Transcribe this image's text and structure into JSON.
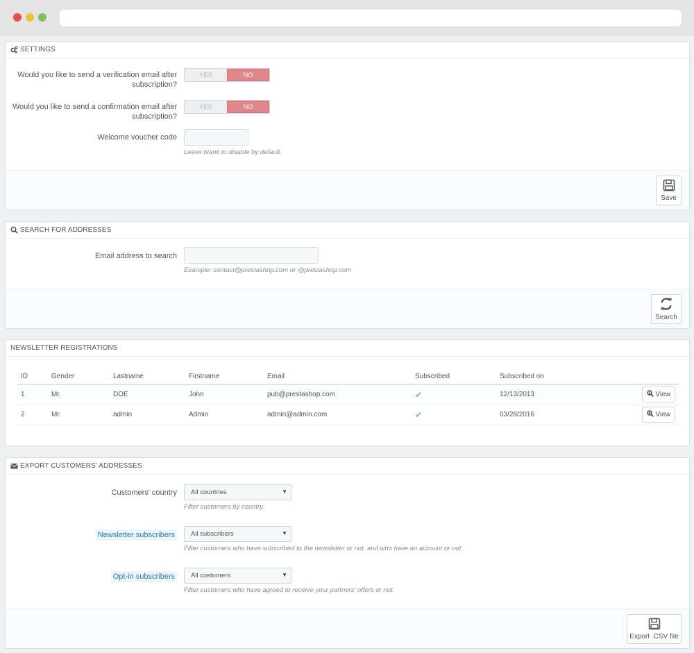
{
  "settings": {
    "title": "Settings",
    "verification_label": "Would you like to send a verification email after subscription?",
    "confirmation_label": "Would you like to send a confirmation email after subscription?",
    "yes": "YES",
    "no": "NO",
    "voucher_label": "Welcome voucher code",
    "voucher_value": "",
    "voucher_help": "Leave blank to disable by default.",
    "save_label": "Save"
  },
  "search": {
    "title": "Search for addresses",
    "email_label": "Email address to search",
    "email_value": "",
    "email_help": "Example: contact@prestashop.com or @prestashop.com",
    "search_label": "Search"
  },
  "registrations": {
    "title": "Newsletter registrations",
    "columns": [
      "ID",
      "Gender",
      "Lastname",
      "Firstname",
      "Email",
      "Subscribed",
      "Subscribed on"
    ],
    "rows": [
      {
        "id": "1",
        "gender": "Mr.",
        "lastname": "DOE",
        "firstname": "John",
        "email": "pub@prestashop.com",
        "subscribed_on": "12/13/2013"
      },
      {
        "id": "2",
        "gender": "Mr.",
        "lastname": "admin",
        "firstname": "Admin",
        "email": "admin@admin.com",
        "subscribed_on": "03/28/2016"
      }
    ],
    "view_label": "View"
  },
  "export": {
    "title": "Export customers' addresses",
    "country_label": "Customers' country",
    "country_value": "All countries",
    "country_help": "Filter customers by country.",
    "newsletter_label": "Newsletter subscribers",
    "newsletter_value": "All subscribers",
    "newsletter_help": "Filter customers who have subscribed to the newsletter or not, and who have an account or not.",
    "optin_label": "Opt-in subscribers",
    "optin_value": "All customers",
    "optin_help": "Filter customers who have agreed to receive your partners' offers or not.",
    "export_label": "Export .CSV file"
  },
  "colors": {
    "no_active": "#e0878c",
    "check": "#72c279",
    "highlight_label": "#2a7ab0"
  }
}
